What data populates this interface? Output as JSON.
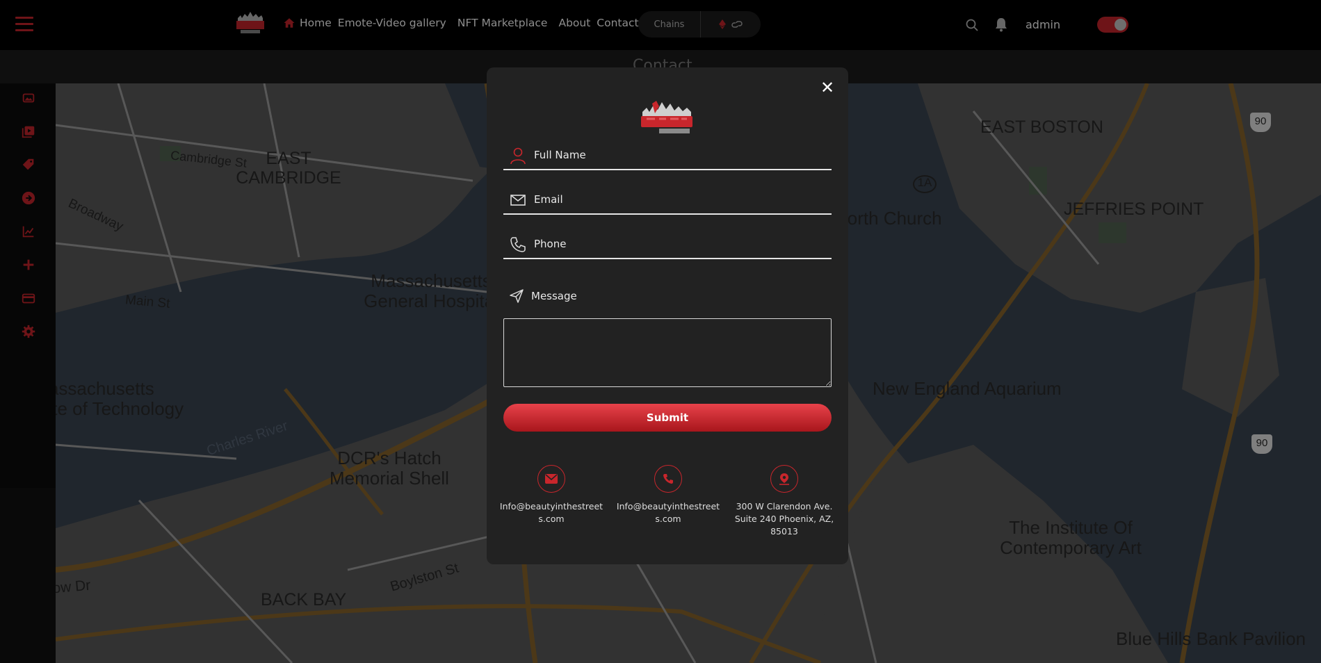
{
  "nav": {
    "items": [
      "Home",
      "Emote-Video gallery",
      "NFT Marketplace",
      "About",
      "Contact"
    ],
    "chains_label": "Chains",
    "user": "admin"
  },
  "page": {
    "title": "Contact"
  },
  "form": {
    "full_name_placeholder": "Full Name",
    "email_placeholder": "Email",
    "phone_placeholder": "Phone",
    "message_label": "Message",
    "submit_label": "Submit",
    "close_symbol": "✕"
  },
  "contacts": [
    {
      "icon": "mail-icon",
      "text": "Info@beautyinthestreets.com"
    },
    {
      "icon": "phone-icon",
      "text": "Info@beautyinthestreets.com"
    },
    {
      "icon": "location-icon",
      "text": "300 W Clarendon Ave. Suite 240 Phoenix, AZ, 85013"
    }
  ],
  "map_labels": [
    "Cambridge St",
    "EAST CAMBRIDGE",
    "Broadway",
    "Main St",
    "Massachusetts General Hospital",
    "Massachusetts Institute of Technology",
    "Charles River",
    "DCR's Hatch Memorial Shell",
    "BACK BAY",
    "Boylston St",
    "Storrow Dr",
    "North Church",
    "EAST BOSTON",
    "JEFFRIES POINT",
    "New England Aquarium",
    "The Institute Of Contemporary Art",
    "Blue Hills Bank Pavilion",
    "1A",
    "90"
  ],
  "colors": {
    "accent": "#c8262c",
    "modal_bg": "#222222",
    "topbar_bg": "#000000"
  }
}
